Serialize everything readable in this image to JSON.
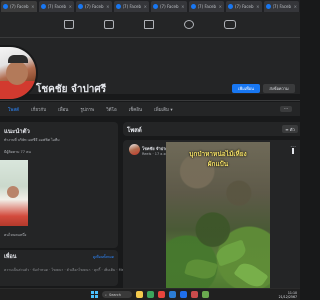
{
  "browser": {
    "tabs": [
      {
        "title": "(7) Faceb"
      },
      {
        "title": "(7) Faceb"
      },
      {
        "title": "(7) Faceb"
      },
      {
        "title": "(7) Faceb"
      },
      {
        "title": "(7) Faceb"
      },
      {
        "title": "(7) Faceb"
      },
      {
        "title": "(7) Faceb"
      },
      {
        "title": "(7) Faceb"
      }
    ],
    "close_glyph": "×"
  },
  "profile": {
    "name": "โชคชัย จำปาศรี",
    "add_friend_label": "เพิ่มเพื่อน",
    "message_label": "ส่งข้อความ"
  },
  "profile_tabs": {
    "items": [
      "โพสต์",
      "เกี่ยวกับ",
      "เพื่อน",
      "รูปภาพ",
      "วิดีโอ",
      "เช็คอิน",
      "เพิ่มเติม ▾"
    ],
    "more": "···"
  },
  "intro": {
    "heading": "แนะนำตัว",
    "line1": "ทำงานที่ บริษัท เอสซีจี ออฟฟิศ ไอทีม",
    "line2": "มีผู้ติดตาม 77 คน",
    "caption": "คนไหนคนหนึ่ง"
  },
  "friends": {
    "heading": "เพื่อน",
    "see_all": "ดูเพื่อนทั้งหมด",
    "footer": "ความเป็นส่วนตัว · ข้อกำหนด · โฆษณา · ตัวเลือกโฆษณา · คุกกี้ · เพิ่มเติม · Meta"
  },
  "posts": {
    "heading": "โพสต์",
    "filter_label": "≡ ตัว",
    "author": "โชคชัย จำปาศรี · ติดตาม",
    "meta": "Reels · 17 ธ.ค. · 🌐",
    "video_line1": "บุกป่าหาหน่อไม้เหี่ยง",
    "video_line2": "ผักแป้น"
  },
  "taskbar": {
    "search_placeholder": "Search",
    "time": "11:10",
    "date": "21/12/2567"
  },
  "colors": {
    "accent": "#1877f2",
    "link": "#2d88ff",
    "background": "#18191a",
    "card": "#242526"
  }
}
